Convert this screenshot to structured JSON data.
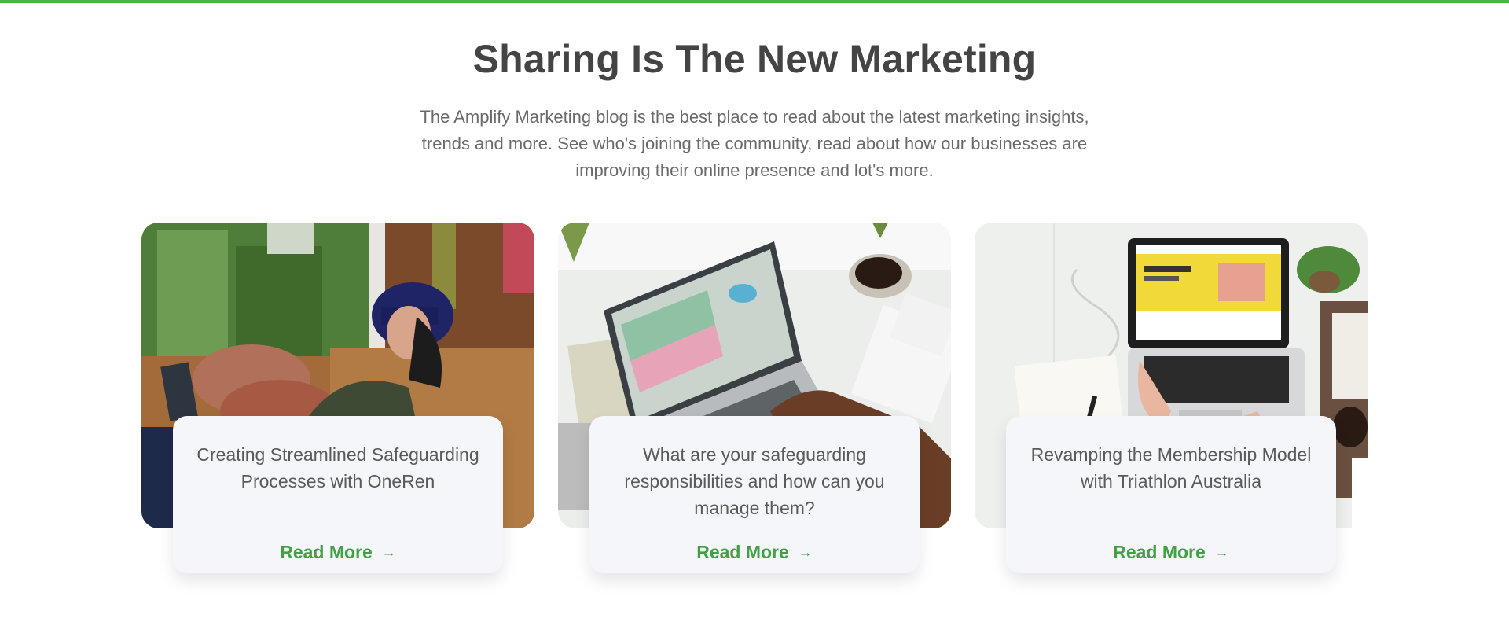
{
  "section": {
    "title": "Sharing Is The New Marketing",
    "intro": "The Amplify Marketing blog is the best place to read about the latest marketing insights, trends and more. See who's joining the community, read about how our businesses are improving their online presence and lot's more."
  },
  "cards": [
    {
      "title": "Creating Streamlined Safeguarding Processes with OneRen",
      "link_label": "Read More",
      "arrow": "→",
      "image": "person-on-couch-with-laptop"
    },
    {
      "title": "What are your safeguarding responsibilities and how can you manage them?",
      "link_label": "Read More",
      "arrow": "→",
      "image": "laptop-with-spreadsheet-and-coffee"
    },
    {
      "title": "Revamping the Membership Model with Triathlon Australia",
      "link_label": "Read More",
      "arrow": "→",
      "image": "laptop-on-desk-with-plant"
    }
  ],
  "colors": {
    "accent": "#4caf50",
    "link": "#43a047",
    "panel": "#f4f6f9",
    "heading": "#444444"
  }
}
